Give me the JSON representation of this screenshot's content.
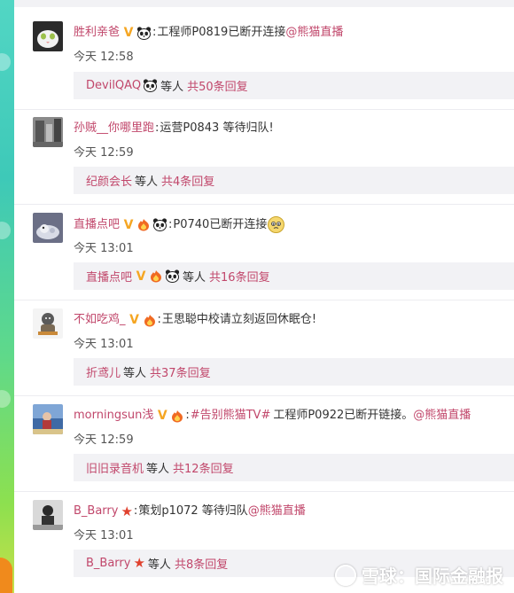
{
  "comments": [
    {
      "user": "胜利亲爸",
      "badges": [
        "v-badge",
        "panda-badge"
      ],
      "text": "工程师P0819已断开连接",
      "mention": "@熊猫直播",
      "time": "今天 12:58",
      "reply_user": "DevilQAQ",
      "reply_badges": [
        "panda-badge"
      ],
      "reply_etc": "等人",
      "reply_count": "共50条回复"
    },
    {
      "user": "孙贼__你哪里跑",
      "badges": [],
      "text": "运营P0843  等待归队!",
      "mention": "",
      "time": "今天 12:59",
      "reply_user": "纪颜会长",
      "reply_badges": [],
      "reply_etc": "等人",
      "reply_count": "共4条回复"
    },
    {
      "user": "直播点吧",
      "badges": [
        "v-badge",
        "fire-badge",
        "panda-badge"
      ],
      "text": "P0740已断开连接",
      "mention": "",
      "time": "今天 13:01",
      "reply_user": "直播点吧",
      "reply_badges": [
        "v-badge",
        "fire-badge",
        "panda-badge"
      ],
      "reply_etc": "等人",
      "reply_count": "共16条回复"
    },
    {
      "user": "不如吃鸡_",
      "badges": [
        "v-badge",
        "fire-badge"
      ],
      "text": "王思聪中校请立刻返回休眠仓!",
      "mention": "",
      "time": "今天 13:01",
      "reply_user": "折鸢儿",
      "reply_badges": [],
      "reply_etc": "等人",
      "reply_count": "共37条回复"
    },
    {
      "user": "morningsun浅",
      "badges": [
        "v-badge",
        "fire-badge"
      ],
      "topic": "#告别熊猫TV#",
      "text": "工程师P0922已断开链接。",
      "mention": "@熊猫直播",
      "time": "今天 12:59",
      "reply_user": "旧旧录音机",
      "reply_badges": [],
      "reply_etc": "等人",
      "reply_count": "共12条回复"
    },
    {
      "user": "B_Barry",
      "badges": [
        "star-badge"
      ],
      "text": "策划p1072 等待归队",
      "mention": "@熊猫直播",
      "time": "今天 13:01",
      "reply_user": "B_Barry",
      "reply_badges": [
        "star-badge"
      ],
      "reply_etc": "等人",
      "reply_count": "共8条回复"
    }
  ],
  "colon": ":",
  "watermark": "雪球：国际金融报",
  "colors": {
    "username": "#c1476b",
    "reply_bg": "#f2f2f5",
    "v_badge": "#f5a623",
    "star": "#e0412e"
  }
}
